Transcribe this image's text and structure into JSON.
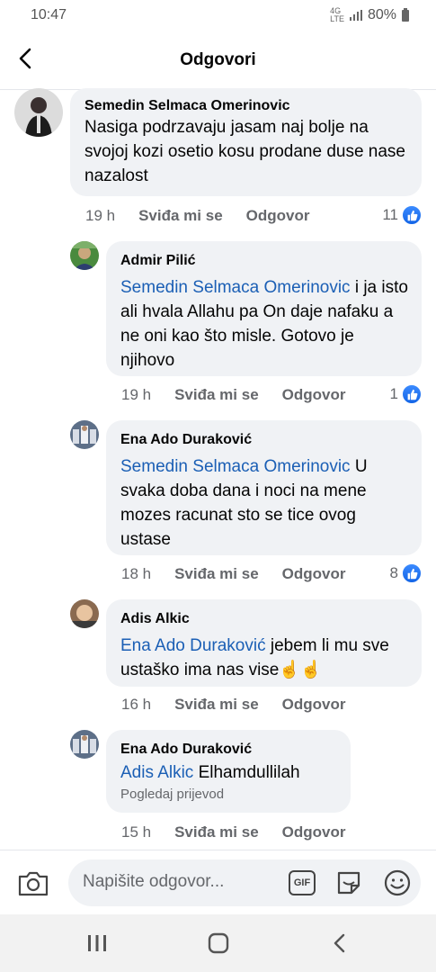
{
  "status_bar": {
    "time": "10:47",
    "network": "4G",
    "network_sub": "LTE",
    "battery": "80%"
  },
  "header": {
    "title": "Odgovori"
  },
  "comments": [
    {
      "author": "Semedin Selmaca Omerinovic",
      "mention": "",
      "text": "Nasiga podrzavaju jasam naj bolje na svojoj kozi osetio  kosu prodane duse nase  nazalost",
      "time": "19 h",
      "like_label": "Sviđa mi se",
      "reply_label": "Odgovor",
      "reactions": "11"
    },
    {
      "author": "Admir Pilić",
      "mention": "Semedin Selmaca Omerinovic",
      "text": " i ja isto ali hvala Allahu pa On daje nafaku a ne oni kao što misle. Gotovo je njihovo",
      "time": "19 h",
      "like_label": "Sviđa mi se",
      "reply_label": "Odgovor",
      "reactions": "1"
    },
    {
      "author": "Ena Ado Duraković",
      "mention": "Semedin Selmaca Omerinovic",
      "text": " U svaka doba dana i noci na mene mozes racunat sto se tice ovog ustase",
      "time": "18 h",
      "like_label": "Sviđa mi se",
      "reply_label": "Odgovor",
      "reactions": "8"
    },
    {
      "author": "Adis Alkic",
      "mention": "Ena Ado Duraković",
      "text": " jebem li mu sve ustaško ima nas vise☝️☝️",
      "time": "16 h",
      "like_label": "Sviđa mi se",
      "reply_label": "Odgovor",
      "reactions": ""
    },
    {
      "author": "Ena Ado Duraković",
      "mention": "Adis Alkic",
      "text": " Elhamdullilah",
      "translate": "Pogledaj prijevod",
      "time": "15 h",
      "like_label": "Sviđa mi se",
      "reply_label": "Odgovor",
      "reactions": ""
    }
  ],
  "composer": {
    "placeholder": "Napišite odgovor...",
    "gif_label": "GIF"
  },
  "colors": {
    "mention": "#1b5fb5",
    "like_blue": "#1877f2",
    "bubble": "#f0f2f5",
    "meta": "#65676b"
  },
  "icons": [
    "back-arrow-icon",
    "like-icon",
    "camera-icon",
    "gif-icon",
    "sticker-icon",
    "emoji-icon",
    "recents-icon",
    "home-icon",
    "nav-back-icon"
  ]
}
